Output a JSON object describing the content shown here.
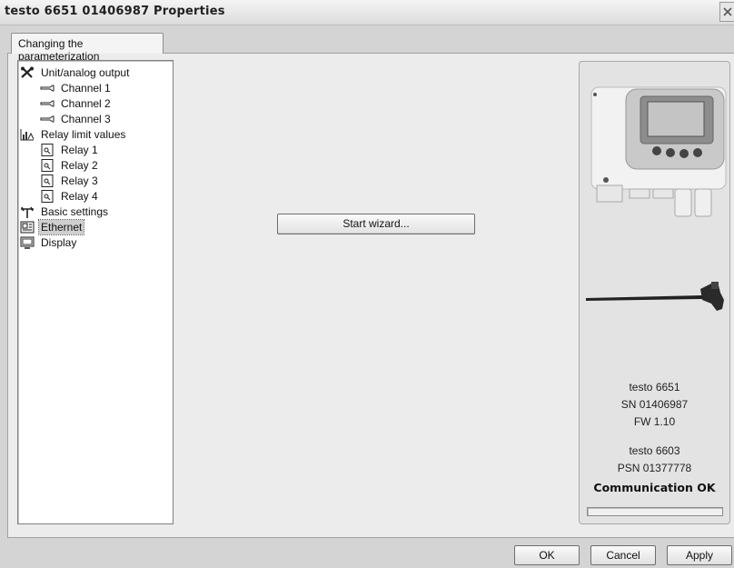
{
  "window": {
    "title": "testo 6651  01406987 Properties"
  },
  "tab": {
    "label": "Changing the parameterization"
  },
  "tree": {
    "items": [
      {
        "label": "Unit/analog output",
        "icon": "tools-icon"
      },
      {
        "label": "Channel 1",
        "icon": "probe-icon"
      },
      {
        "label": "Channel 2",
        "icon": "probe-icon"
      },
      {
        "label": "Channel 3",
        "icon": "probe-icon"
      },
      {
        "label": "Relay limit values",
        "icon": "chart-icon"
      },
      {
        "label": "Relay 1",
        "icon": "relay-icon"
      },
      {
        "label": "Relay 2",
        "icon": "relay-icon"
      },
      {
        "label": "Relay 3",
        "icon": "relay-icon"
      },
      {
        "label": "Relay 4",
        "icon": "relay-icon"
      },
      {
        "label": "Basic settings",
        "icon": "settings-icon"
      },
      {
        "label": "Ethernet",
        "icon": "network-icon",
        "selected": true
      },
      {
        "label": "Display",
        "icon": "display-icon"
      }
    ]
  },
  "main": {
    "wizard_label": "Start wizard..."
  },
  "device": {
    "transmitter_model": "testo 6651",
    "serial": "SN 01406987",
    "firmware": "FW 1.10",
    "probe_model": "testo 6603",
    "probe_serial": "PSN 01377778",
    "status": "Communication OK",
    "progress": 0
  },
  "buttons": {
    "ok": "OK",
    "cancel": "Cancel",
    "apply": "Apply"
  }
}
